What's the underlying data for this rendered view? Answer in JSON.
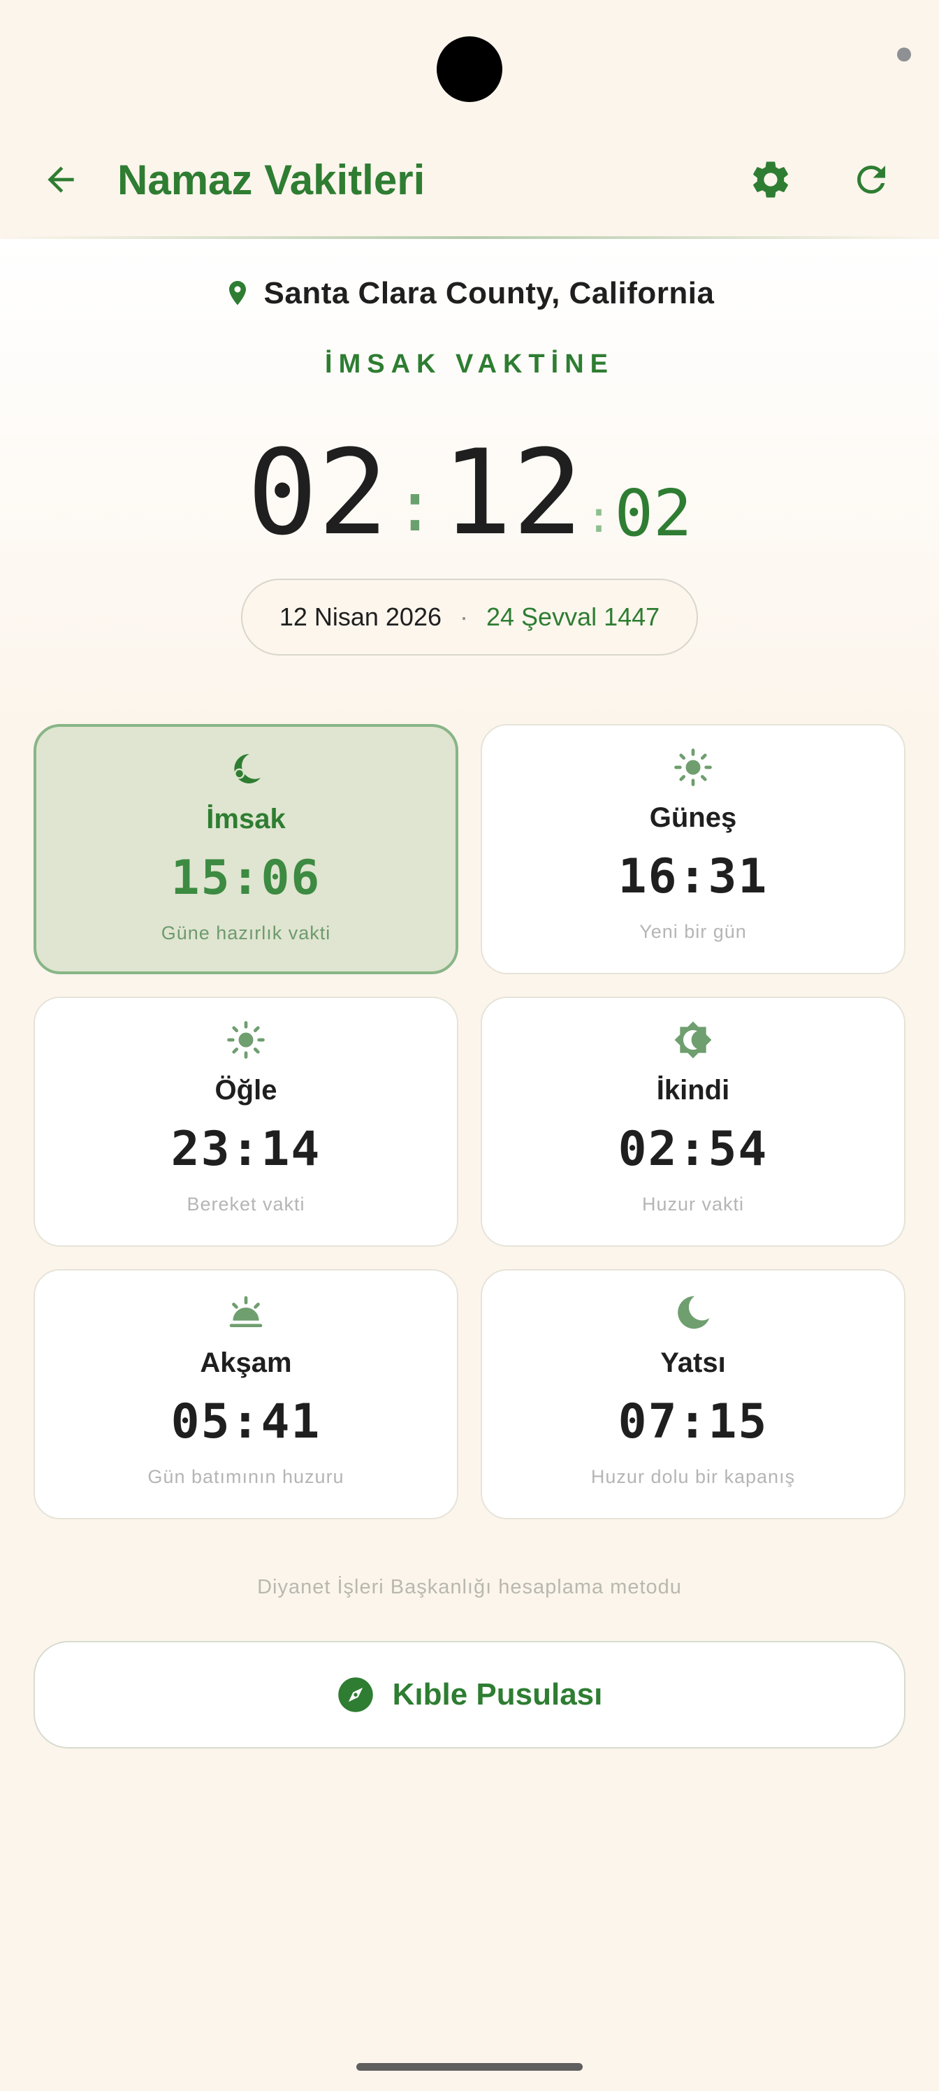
{
  "app": {
    "title": "Namaz Vakitleri",
    "accent_color": "#2e7d32",
    "background_color": "#fcf5ec"
  },
  "toolbar": {
    "back_icon": "arrow-left-icon",
    "settings_icon": "gear-icon",
    "refresh_icon": "refresh-icon"
  },
  "location": {
    "icon": "location-pin-icon",
    "text": "Santa Clara County, California"
  },
  "countdown": {
    "label": "İMSAK VAKTİNE",
    "hours": "02",
    "minutes": "12",
    "seconds": "02"
  },
  "date": {
    "gregorian": "12 Nisan 2026",
    "separator": "·",
    "hijri": "24 Şevval 1447"
  },
  "prayers": [
    {
      "name": "İmsak",
      "time": "15:06",
      "subtitle": "Güne hazırlık vakti",
      "icon": "crescent-moon-icon",
      "active": true
    },
    {
      "name": "Güneş",
      "time": "16:31",
      "subtitle": "Yeni bir gün",
      "icon": "sun-icon",
      "active": false
    },
    {
      "name": "Öğle",
      "time": "23:14",
      "subtitle": "Bereket vakti",
      "icon": "sun-icon",
      "active": false
    },
    {
      "name": "İkindi",
      "time": "02:54",
      "subtitle": "Huzur vakti",
      "icon": "brightness-icon",
      "active": false
    },
    {
      "name": "Akşam",
      "time": "05:41",
      "subtitle": "Gün batımının huzuru",
      "icon": "sunset-icon",
      "active": false
    },
    {
      "name": "Yatsı",
      "time": "07:15",
      "subtitle": "Huzur dolu bir kapanış",
      "icon": "moon-icon",
      "active": false
    }
  ],
  "footer": {
    "method_text": "Diyanet İşleri Başkanlığı hesaplama metodu",
    "qibla_label": "Kıble Pusulası",
    "qibla_icon": "compass-icon"
  }
}
